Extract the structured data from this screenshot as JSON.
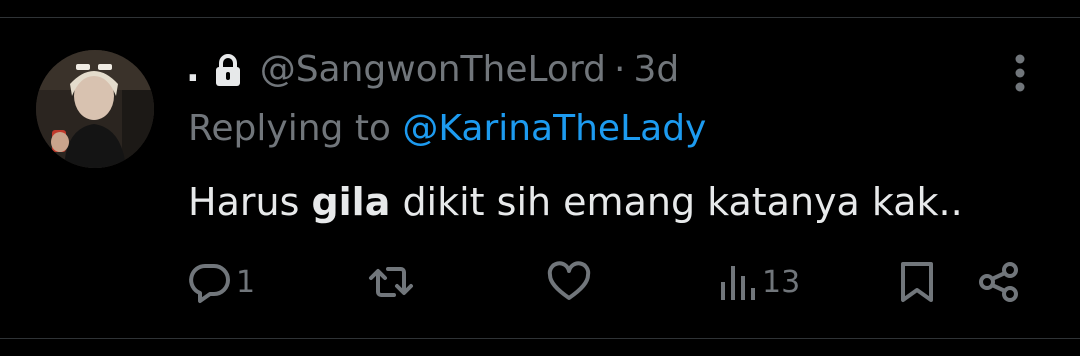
{
  "tweet": {
    "display_name": ".",
    "handle": "@SangwonTheLord",
    "separator": "·",
    "time": "3d",
    "replying_prefix": "Replying to ",
    "replying_to": "@KarinaTheLady",
    "text_before": "Harus ",
    "text_bold": "gila",
    "text_after": " dikit sih emang katanya kak.."
  },
  "actions": {
    "reply_count": "1",
    "view_count": "13"
  },
  "icons": {
    "lock": "lock-icon",
    "more": "more-vertical-icon",
    "reply": "reply-icon",
    "retweet": "retweet-icon",
    "like": "heart-icon",
    "views": "views-icon",
    "bookmark": "bookmark-icon",
    "share": "share-icon"
  },
  "colors": {
    "background": "#000000",
    "text": "#e7e9ea",
    "muted": "#71767b",
    "link": "#1d9bf0",
    "divider": "#2f3336"
  }
}
